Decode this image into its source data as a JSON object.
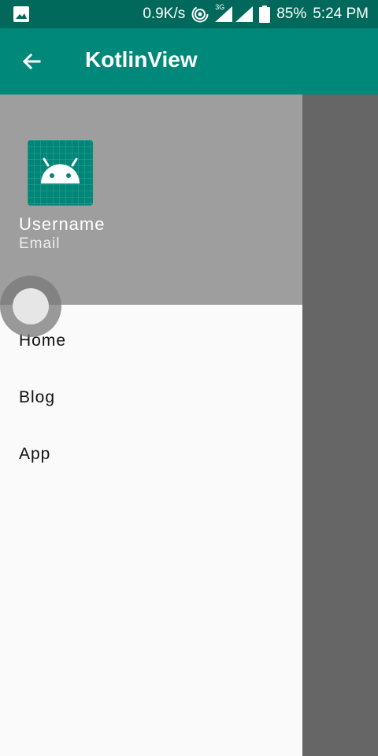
{
  "status_bar": {
    "speed": "0.9K/s",
    "network": "3G",
    "battery": "85%",
    "time": "5:24 PM",
    "icons": [
      "image-icon",
      "hotspot-icon",
      "signal-icon",
      "battery-icon"
    ]
  },
  "app_bar": {
    "title": "KotlinView",
    "back_icon": "arrow-back-icon"
  },
  "drawer": {
    "header": {
      "username": "Username",
      "email": "Email",
      "avatar_icon": "android-icon"
    },
    "items": [
      {
        "label": "Home"
      },
      {
        "label": "Blog"
      },
      {
        "label": "App"
      }
    ]
  },
  "colors": {
    "primary": "#00897b",
    "primary_dark": "#00695c",
    "header_bg": "#9e9e9e",
    "drawer_bg": "#fafafa",
    "scrim": "#666666"
  }
}
